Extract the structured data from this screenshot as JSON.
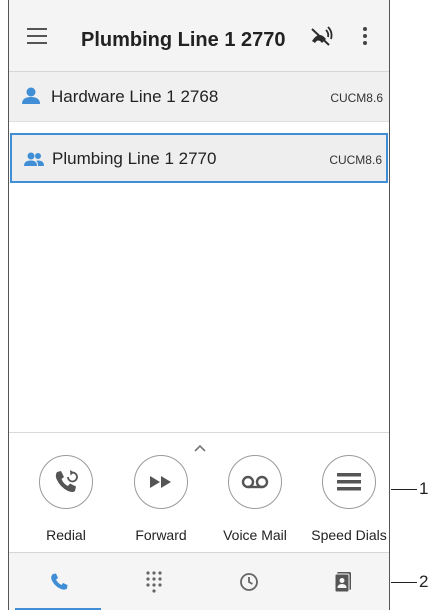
{
  "header": {
    "title": "Plumbing Line 1 2770",
    "icons": [
      "menu-icon",
      "do-not-disturb-icon",
      "more-vert-icon"
    ]
  },
  "lines": [
    {
      "label": "Hardware Line 1 2768",
      "tag": "CUCM8.6",
      "icon": "single-user-icon",
      "selected": false
    },
    {
      "label": "Plumbing Line 1 2770",
      "tag": "CUCM8.6",
      "icon": "group-users-icon",
      "selected": true
    }
  ],
  "actions": [
    {
      "label": "Redial",
      "icon": "redial-icon"
    },
    {
      "label": "Forward",
      "icon": "forward-icon"
    },
    {
      "label": "Voice Mail",
      "icon": "voicemail-icon"
    },
    {
      "label": "Speed Dials",
      "icon": "speed-dials-icon"
    }
  ],
  "bottom_nav": {
    "items": [
      "phone-icon",
      "dialpad-icon",
      "recents-icon",
      "contacts-icon"
    ],
    "active_index": 0
  },
  "callouts": {
    "first": "1",
    "second": "2"
  },
  "colors": {
    "accent": "#3f8ed6",
    "icon_gray": "#555555"
  }
}
